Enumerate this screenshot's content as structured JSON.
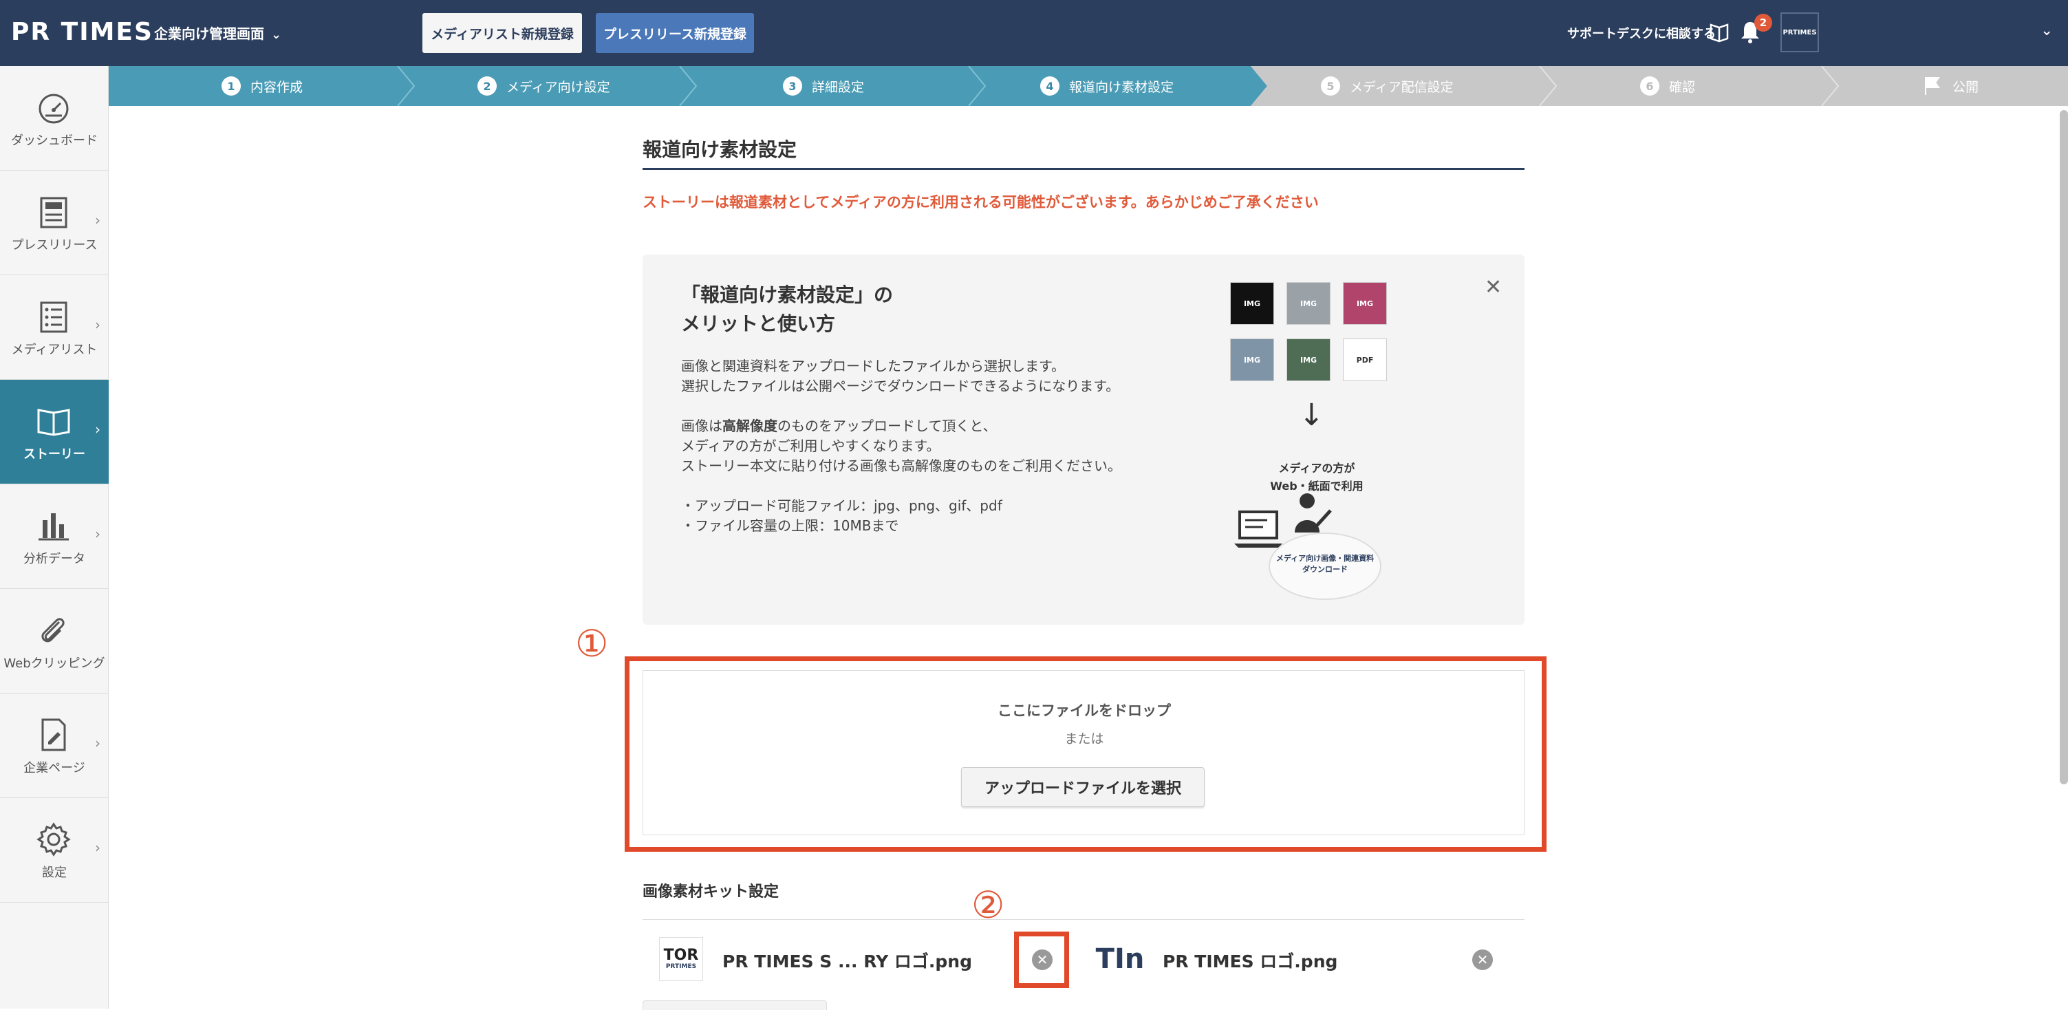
{
  "header": {
    "logo": "PR TIMES",
    "company_menu": "企業向け管理画面",
    "media_register_btn": "メディアリスト新規登録",
    "press_register_btn": "プレスリリース新規登録",
    "support_text": "サポートデスクに相談する",
    "notification_count": "2",
    "avatar_text": "PRTIMES"
  },
  "sidebar": {
    "items": [
      {
        "label": "ダッシュボード",
        "icon": "dashboard-icon"
      },
      {
        "label": "プレスリリース",
        "icon": "document-icon"
      },
      {
        "label": "メディアリスト",
        "icon": "list-icon"
      },
      {
        "label": "ストーリー",
        "icon": "book-icon",
        "active": true
      },
      {
        "label": "分析データ",
        "icon": "bar-chart-icon"
      },
      {
        "label": "Webクリッピング",
        "icon": "paperclip-icon"
      },
      {
        "label": "企業ページ",
        "icon": "edit-page-icon"
      },
      {
        "label": "設定",
        "icon": "gear-icon"
      }
    ]
  },
  "steps": [
    {
      "num": "1",
      "label": "内容作成",
      "state": "done"
    },
    {
      "num": "2",
      "label": "メディア向け設定",
      "state": "done"
    },
    {
      "num": "3",
      "label": "詳細設定",
      "state": "done"
    },
    {
      "num": "4",
      "label": "報道向け素材設定",
      "state": "current"
    },
    {
      "num": "5",
      "label": "メディア配信設定",
      "state": "todo"
    },
    {
      "num": "6",
      "label": "確認",
      "state": "todo"
    },
    {
      "num": "",
      "label": "公開",
      "state": "todo"
    }
  ],
  "main": {
    "title": "報道向け素材設定",
    "warning": "ストーリーは報道素材としてメディアの方に利用される可能性がございます。あらかじめご了承ください",
    "info": {
      "title_line1": "「報道向け素材設定」の",
      "title_line2": "メリットと使い方",
      "p1_l1": "画像と関連資料をアップロードしたファイルから選択します。",
      "p1_l2": "選択したファイルは公開ページでダウンロードできるようになります。",
      "p2_l1_a": "画像は",
      "p2_l1_bold": "高解像度",
      "p2_l1_b": "のものをアップロードして頂くと、",
      "p2_l2": "メディアの方がご利用しやすくなります。",
      "p2_l3": "ストーリー本文に貼り付ける画像も高解像度のものをご利用ください。",
      "p3_l1": "・アップロード可能ファイル：jpg、png、gif、pdf",
      "p3_l2": "・ファイル容量の上限：10MBまで",
      "media_use_l1": "メディアの方が",
      "media_use_l2": "Web・紙面で利用",
      "download_l1": "メディア向け画像・関連資料",
      "download_l2": "ダウンロード",
      "thumbs": [
        "IMG",
        "IMG",
        "IMG",
        "IMG",
        "IMG",
        "PDF"
      ]
    },
    "annotation1": "①",
    "annotation2": "②",
    "dropzone": {
      "title": "ここにファイルをドロップ",
      "or": "または",
      "button": "アップロードファイルを選択"
    },
    "kit": {
      "title": "画像素材キット設定",
      "files": [
        {
          "name": "PR TIMES S ... RY ロゴ.png",
          "icon_text": "TOR"
        },
        {
          "name": "PR TIMES ロゴ.png",
          "icon_text": "TIn"
        }
      ]
    }
  }
}
